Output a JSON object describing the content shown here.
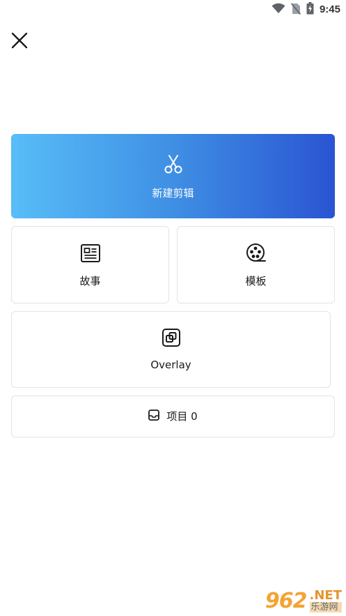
{
  "status_bar": {
    "time": "9:45",
    "icons": [
      "wifi-icon",
      "no-sim-icon",
      "battery-charging-icon"
    ]
  },
  "header": {
    "close_icon": "close-icon"
  },
  "actions": {
    "new_edit": {
      "label": "新建剪辑",
      "icon": "scissors-icon"
    },
    "story": {
      "label": "故事",
      "icon": "newspaper-icon"
    },
    "template": {
      "label": "模板",
      "icon": "film-reel-icon"
    },
    "overlay": {
      "label": "Overlay",
      "icon": "overlay-icon"
    },
    "projects": {
      "label": "项目 0",
      "icon": "inbox-icon"
    }
  },
  "colors": {
    "gradient_start": "#58bdf8",
    "gradient_end": "#2a54d2",
    "card_border": "#e3e3e3"
  },
  "watermark": {
    "big": "962",
    "net": ".NET",
    "sub": "乐游网"
  }
}
